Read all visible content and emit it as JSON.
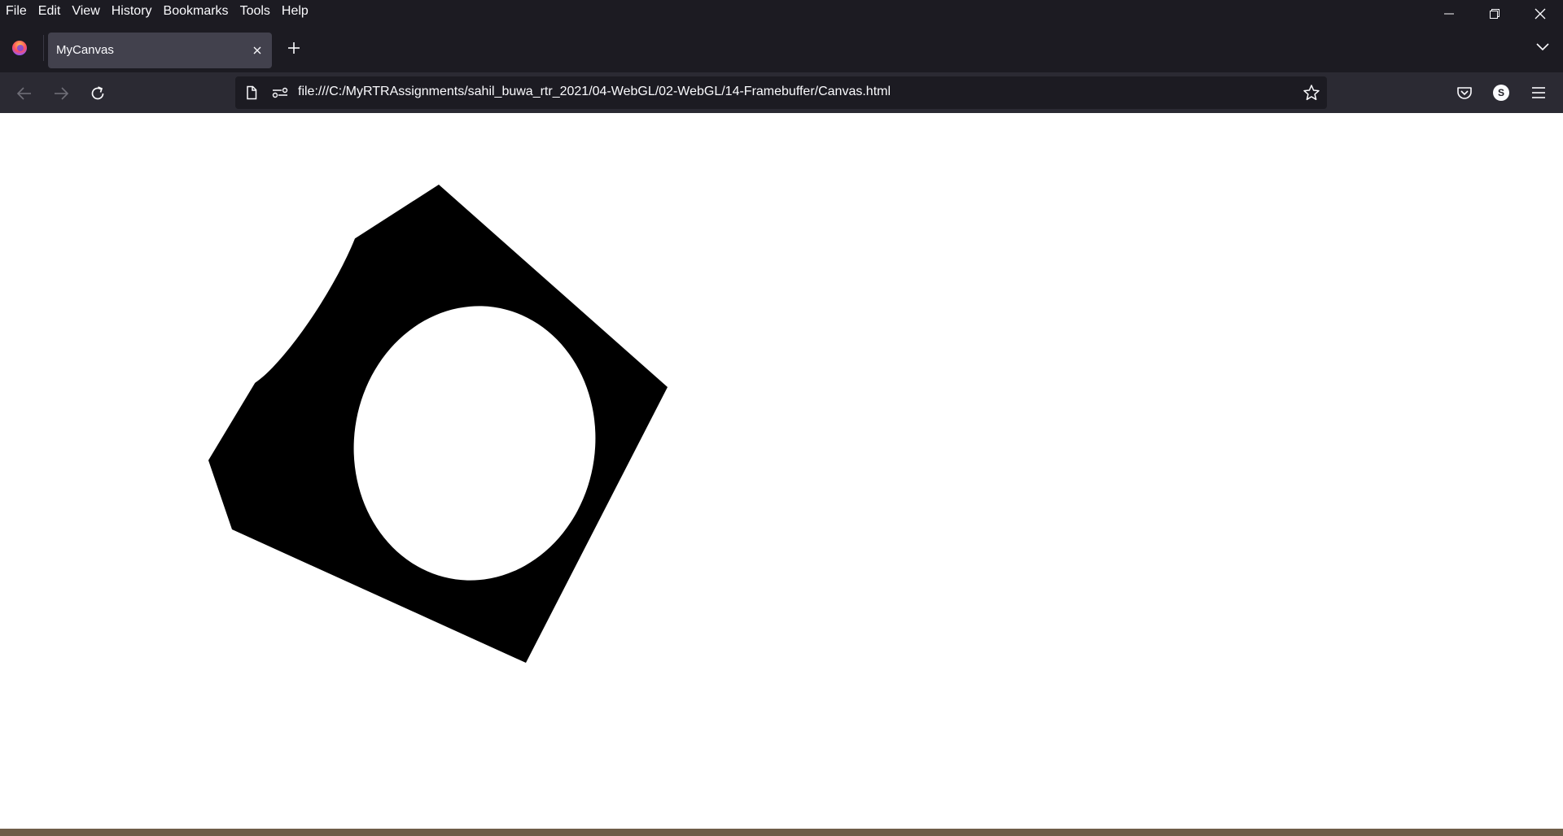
{
  "menubar": {
    "items": [
      "File",
      "Edit",
      "View",
      "History",
      "Bookmarks",
      "Tools",
      "Help"
    ]
  },
  "window_controls": {
    "icons": [
      "minimize-icon",
      "restore-icon",
      "close-icon"
    ]
  },
  "tabs": [
    {
      "label": "MyCanvas",
      "active": true
    }
  ],
  "navbar": {
    "url": "file:///C:/MyRTRAssignments/sahil_buwa_rtr_2021/04-WebGL/02-WebGL/14-Framebuffer/Canvas.html",
    "account_initial": "S"
  },
  "colors": {
    "chrome_dark": "#1c1b22",
    "toolbar": "#2b2a33",
    "tab_active": "#42414d",
    "text": "#fbfbfe",
    "canvas_bg": "#ffffff",
    "cube_face": "#000000"
  }
}
